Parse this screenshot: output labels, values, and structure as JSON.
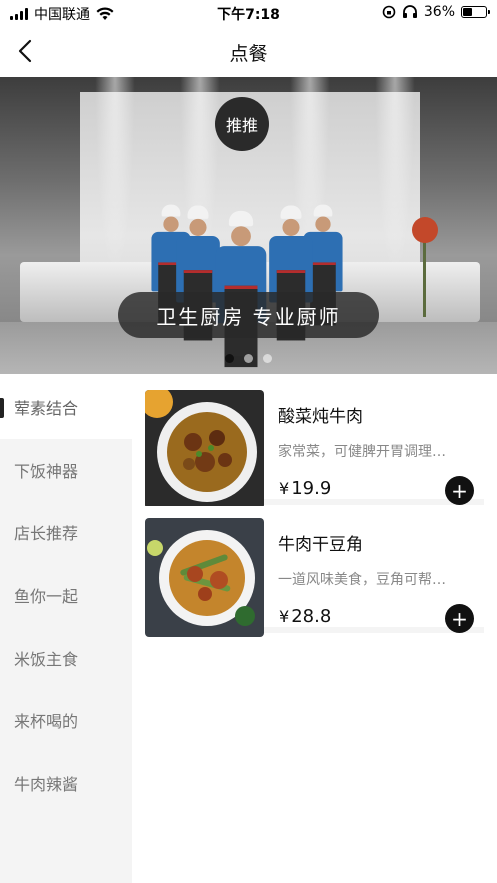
{
  "status_bar": {
    "carrier": "中国联通",
    "time": "下午7:18",
    "battery": "36%",
    "battery_level": 0.36,
    "icons": [
      "signal-icon",
      "wifi-icon",
      "rotation-lock-icon",
      "headphones-icon",
      "battery-icon"
    ]
  },
  "navbar": {
    "title": "点餐",
    "back_icon": "chevron-left-icon"
  },
  "banner": {
    "slogan": "卫生厨房 专业厨师",
    "logo_text": "推推",
    "slide_count": 3,
    "active_slide": 0
  },
  "categories": [
    {
      "label": "荤素结合",
      "active": true
    },
    {
      "label": "下饭神器",
      "active": false
    },
    {
      "label": "店长推荐",
      "active": false
    },
    {
      "label": "鱼你一起",
      "active": false
    },
    {
      "label": "米饭主食",
      "active": false
    },
    {
      "label": "来杯喝的",
      "active": false
    },
    {
      "label": "牛肉辣酱",
      "active": false
    }
  ],
  "dishes": [
    {
      "name": "酸菜炖牛肉",
      "desc": "家常菜，可健脾开胃调理…",
      "price": "19.9",
      "currency": "¥"
    },
    {
      "name": "牛肉干豆角",
      "desc": "一道风味美食，豆角可帮…",
      "price": "28.8",
      "currency": "¥"
    }
  ],
  "colors": {
    "accent": "#111111",
    "sidebar_bg": "#f4f4f4",
    "muted_text": "#888888"
  }
}
